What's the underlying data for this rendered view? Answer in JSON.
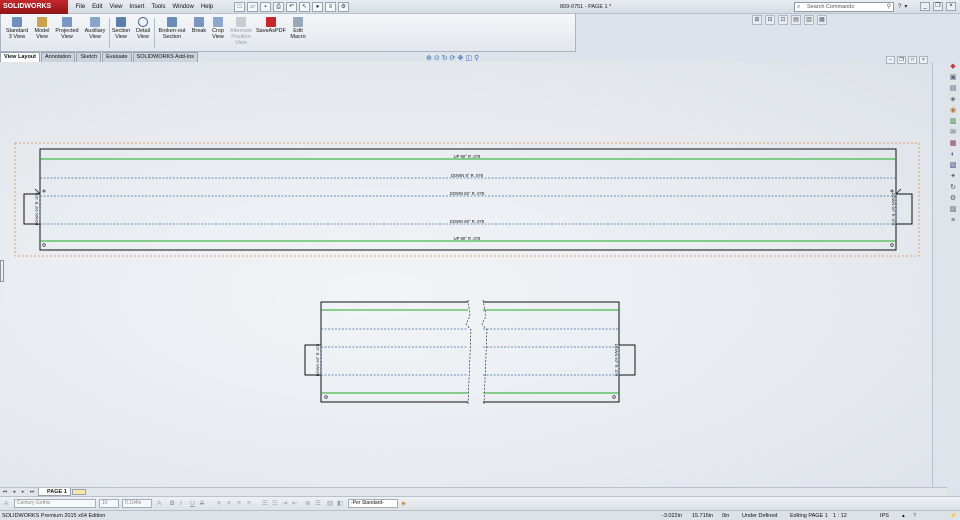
{
  "titlebar": {
    "logo": "SOLIDWORKS",
    "menu": [
      "File",
      "Edit",
      "View",
      "Insert",
      "Tools",
      "Window",
      "Help"
    ],
    "document_title": "809-0751 - PAGE 1 *",
    "search_placeholder": "Search Commands"
  },
  "commands": [
    {
      "label": "Standard\n3 View",
      "icon": "standard-3-view-icon",
      "disabled": false
    },
    {
      "label": "Model\nView",
      "icon": "model-view-icon",
      "disabled": false
    },
    {
      "label": "Projected\nView",
      "icon": "projected-view-icon",
      "disabled": false
    },
    {
      "label": "Auxiliary\nView",
      "icon": "auxiliary-view-icon",
      "disabled": false
    },
    {
      "label": "Section\nView",
      "icon": "section-view-icon",
      "disabled": false
    },
    {
      "label": "Detail\nView",
      "icon": "detail-view-icon",
      "disabled": false
    },
    {
      "label": "Broken-out\nSection",
      "icon": "broken-out-section-icon",
      "disabled": false
    },
    {
      "label": "Break",
      "icon": "break-icon",
      "disabled": false
    },
    {
      "label": "Crop\nView",
      "icon": "crop-view-icon",
      "disabled": false
    },
    {
      "label": "Alternate\nPosition\nView",
      "icon": "alternate-position-view-icon",
      "disabled": true
    },
    {
      "label": "SaveAsPDF",
      "icon": "pdf-icon",
      "disabled": false
    },
    {
      "label": "Edit\nMacro",
      "icon": "edit-macro-icon",
      "disabled": false
    }
  ],
  "tabs": [
    {
      "label": "View Layout",
      "active": true
    },
    {
      "label": "Annotation",
      "active": false
    },
    {
      "label": "Sketch",
      "active": false
    },
    {
      "label": "Evaluate",
      "active": false
    },
    {
      "label": "SOLIDWORKS Add-Ins",
      "active": false
    }
  ],
  "drawing": {
    "top_view_bend_notes": [
      "UP 90° R .078",
      "DOWN 8° R .078",
      "DOWN 82° R .078",
      "DOWN 90° R .078",
      "UP 90° R .078"
    ],
    "side_flange_note": "DOWN 90° R .078"
  },
  "sheet_tab": "PAGE 1",
  "format_bar": {
    "font": "Century Gothic",
    "font_size": "10",
    "height": "0.104in",
    "layer": "-Per Standard-"
  },
  "status": {
    "product": "SOLIDWORKS Premium 2015 x64 Edition",
    "x": "-3.022in",
    "y": "15.716in",
    "z": "0in",
    "definition": "Under Defined",
    "editing": "Editing PAGE 1",
    "scale": "1 : 12",
    "units": "IPS"
  },
  "colors": {
    "brand_red": "#b5202a",
    "bend_up_line": "#22aa22",
    "bend_down_line": "#3a6ea8",
    "view_boundary": "#e08a4a"
  }
}
